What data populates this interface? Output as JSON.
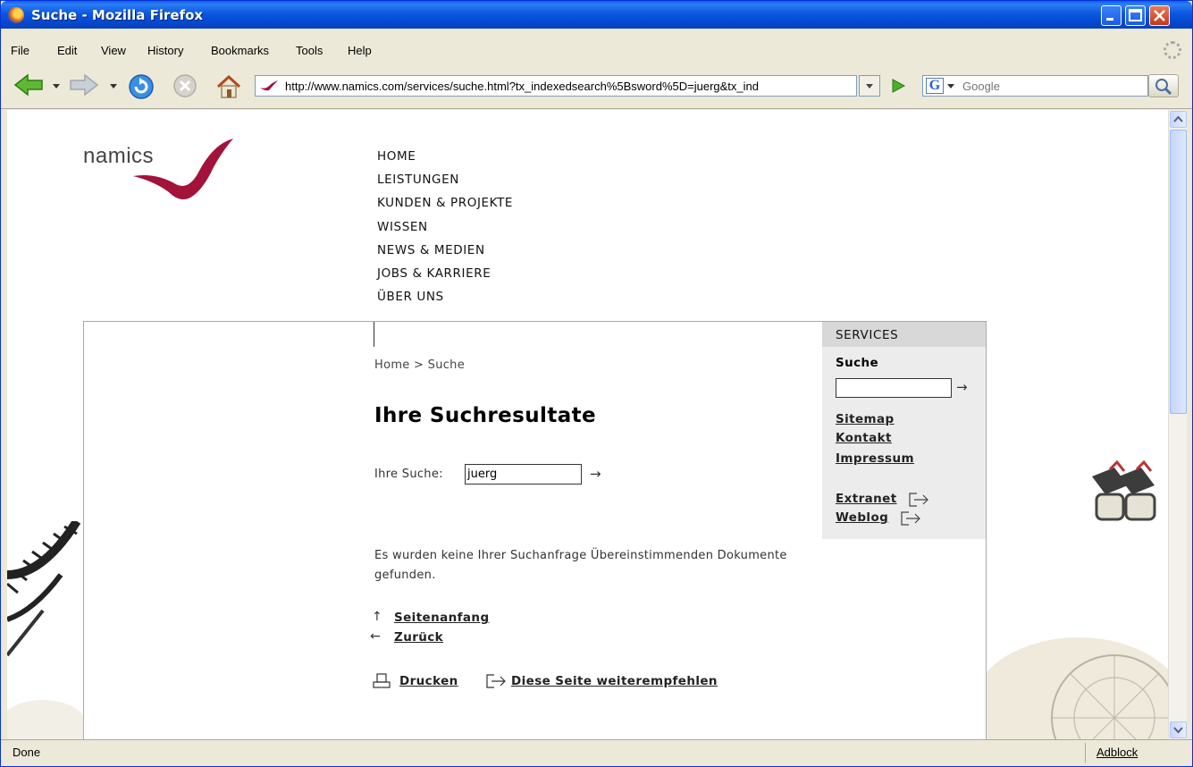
{
  "window": {
    "title": "Suche - Mozilla Firefox"
  },
  "menu": [
    "File",
    "Edit",
    "View",
    "History",
    "Bookmarks",
    "Tools",
    "Help"
  ],
  "toolbar": {
    "url": "http://www.namics.com/services/suche.html?tx_indexedsearch%5Bsword%5D=juerg&tx_ind",
    "search_placeholder": "Google"
  },
  "page": {
    "logo_text": "namics",
    "nav": [
      "HOME",
      "LEISTUNGEN",
      "KUNDEN & PROJEKTE",
      "WISSEN",
      "NEWS & MEDIEN",
      "JOBS & KARRIERE",
      "ÜBER UNS"
    ],
    "breadcrumb": "Home > Suche",
    "title": "Ihre Suchresultate",
    "search_label": "Ihre Suche:",
    "search_value": "juerg",
    "no_results": "Es wurden keine Ihrer Suchanfrage Übereinstimmenden Dokumente gefunden.",
    "links": {
      "top": "Seitenanfang",
      "back": "Zurück",
      "print": "Drucken",
      "recommend": "Diese Seite weiterempfehlen"
    },
    "services": {
      "heading": "SERVICES",
      "search_label": "Suche",
      "sitemap": "Sitemap",
      "contact": "Kontakt",
      "imprint": "Impressum",
      "extranet": "Extranet",
      "weblog": "Weblog"
    }
  },
  "status": {
    "text": "Done",
    "addon": "Adblock"
  },
  "colors": {
    "titlebar": "#0b58de",
    "logo_accent": "#a3123a",
    "chrome": "#ece9d8"
  }
}
